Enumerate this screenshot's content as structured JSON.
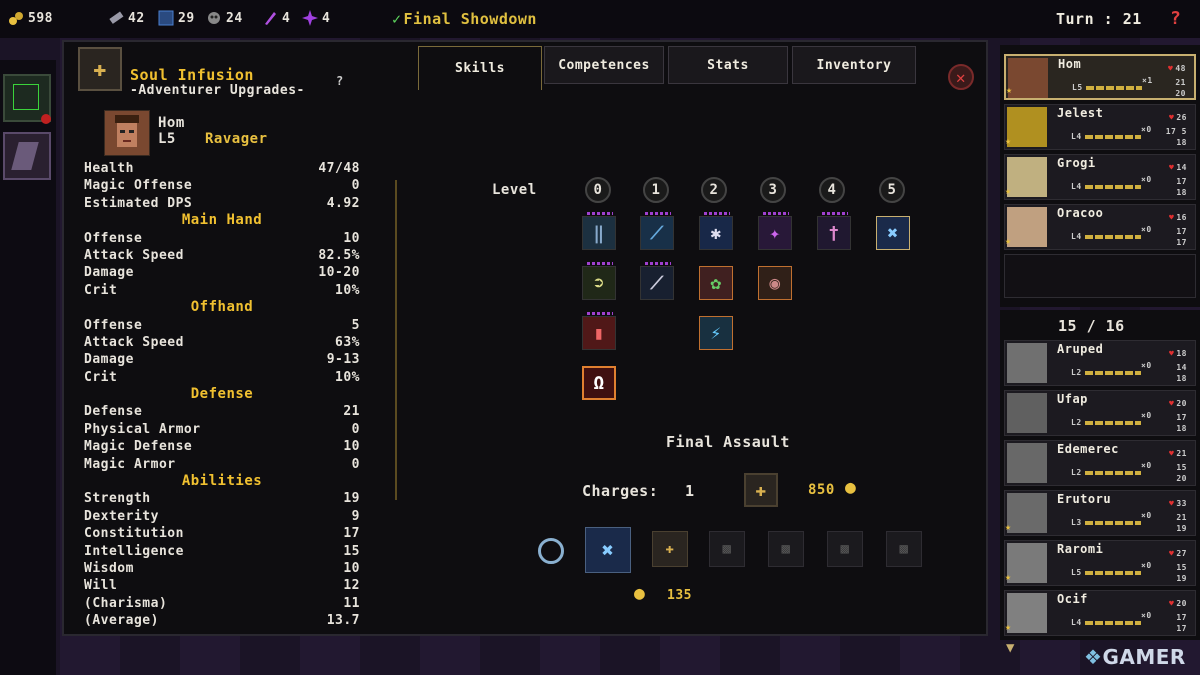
{
  "resources": [
    {
      "name": "gold",
      "value": "598",
      "icon": "coins-icon",
      "color": "#e8c040"
    },
    {
      "name": "ore",
      "value": "42",
      "icon": "ingot-icon",
      "color": "#9a9aa8"
    },
    {
      "name": "scrolls",
      "value": "29",
      "icon": "rune-icon",
      "color": "#4a80d0"
    },
    {
      "name": "bones",
      "value": "24",
      "icon": "bones-icon",
      "color": "#cccccc"
    },
    {
      "name": "shards",
      "value": "4",
      "icon": "crystal-icon",
      "color": "#b050e0"
    },
    {
      "name": "essence",
      "value": "4",
      "icon": "spark-icon",
      "color": "#a040e0"
    }
  ],
  "objective": {
    "check": "✓",
    "text": "Final Showdown"
  },
  "turn": {
    "label": "Turn : 21",
    "help": "?"
  },
  "upgrade": {
    "title": "Soul Infusion",
    "subtitle": "-Adventurer Upgrades-",
    "help": "?"
  },
  "hero": {
    "name": "Hom",
    "level": "L5",
    "class": "Ravager"
  },
  "stats": {
    "rows1": [
      {
        "label": "Health",
        "value": "47/48"
      },
      {
        "label": "Magic Offense",
        "value": "0"
      },
      {
        "label": "Estimated DPS",
        "value": "4.92"
      }
    ],
    "main_hand_title": "Main Hand",
    "main_hand": [
      {
        "label": "Offense",
        "value": "10"
      },
      {
        "label": "Attack Speed",
        "value": "82.5%"
      },
      {
        "label": "Damage",
        "value": "10-20"
      },
      {
        "label": "Crit",
        "value": "10%"
      }
    ],
    "offhand_title": "Offhand",
    "offhand": [
      {
        "label": "Offense",
        "value": "5"
      },
      {
        "label": "Attack Speed",
        "value": "63%"
      },
      {
        "label": "Damage",
        "value": "9-13"
      },
      {
        "label": "Crit",
        "value": "10%"
      }
    ],
    "defense_title": "Defense",
    "defense": [
      {
        "label": "Defense",
        "value": "21"
      },
      {
        "label": "Physical Armor",
        "value": "0"
      },
      {
        "label": "Magic Defense",
        "value": "10"
      },
      {
        "label": "Magic Armor",
        "value": "0"
      }
    ],
    "abilities_title": "Abilities",
    "abilities": [
      {
        "label": "Strength",
        "value": "19"
      },
      {
        "label": "Dexterity",
        "value": "9"
      },
      {
        "label": "Constitution",
        "value": "17"
      },
      {
        "label": "Intelligence",
        "value": "15"
      },
      {
        "label": "Wisdom",
        "value": "10"
      },
      {
        "label": "Will",
        "value": "12"
      },
      {
        "label": "(Charisma)",
        "value": "11"
      },
      {
        "label": "(Average)",
        "value": "13.7"
      }
    ]
  },
  "tabs": [
    "Skills",
    "Competences",
    "Stats",
    "Inventory"
  ],
  "active_tab": "Skills",
  "skill_tree": {
    "level_label": "Level",
    "levels": [
      "0",
      "1",
      "2",
      "3",
      "4",
      "5"
    ]
  },
  "selected_skill": {
    "name": "Final Assault",
    "charges_label": "Charges:",
    "charges": "1",
    "cost": "850"
  },
  "bottom_cost": "135",
  "roster": [
    {
      "name": "Hom",
      "hp": "48",
      "skull": "×1",
      "arm": "21",
      "lvl": "L5",
      "wis": "20"
    },
    {
      "name": "Jelest",
      "hp": "26",
      "skull": "×0",
      "arm": "17 5",
      "lvl": "L4",
      "wis": "18"
    },
    {
      "name": "Grogi",
      "hp": "14",
      "skull": "×0",
      "arm": "17",
      "lvl": "L4",
      "wis": "18"
    },
    {
      "name": "Oracoo",
      "hp": "16",
      "skull": "×0",
      "arm": "17",
      "lvl": "L4",
      "wis": "17"
    }
  ],
  "bench_count": "15 / 16",
  "bench": [
    {
      "name": "Aruped",
      "hp": "18",
      "skull": "×0",
      "arm": "14",
      "lvl": "L2",
      "wis": "18"
    },
    {
      "name": "Ufap",
      "hp": "20",
      "skull": "×0",
      "arm": "17",
      "lvl": "L2",
      "wis": "18"
    },
    {
      "name": "Edemerec",
      "hp": "21",
      "skull": "×0",
      "arm": "15",
      "lvl": "L2",
      "wis": "20"
    },
    {
      "name": "Erutoru",
      "hp": "33",
      "skull": "×0",
      "arm": "21",
      "lvl": "L3",
      "wis": "19"
    },
    {
      "name": "Raromi",
      "hp": "27",
      "skull": "×0",
      "arm": "15",
      "lvl": "L5",
      "wis": "19"
    },
    {
      "name": "Ocif",
      "hp": "20",
      "skull": "×0",
      "arm": "17",
      "lvl": "L4",
      "wis": "17"
    }
  ],
  "watermark": "GAMER"
}
